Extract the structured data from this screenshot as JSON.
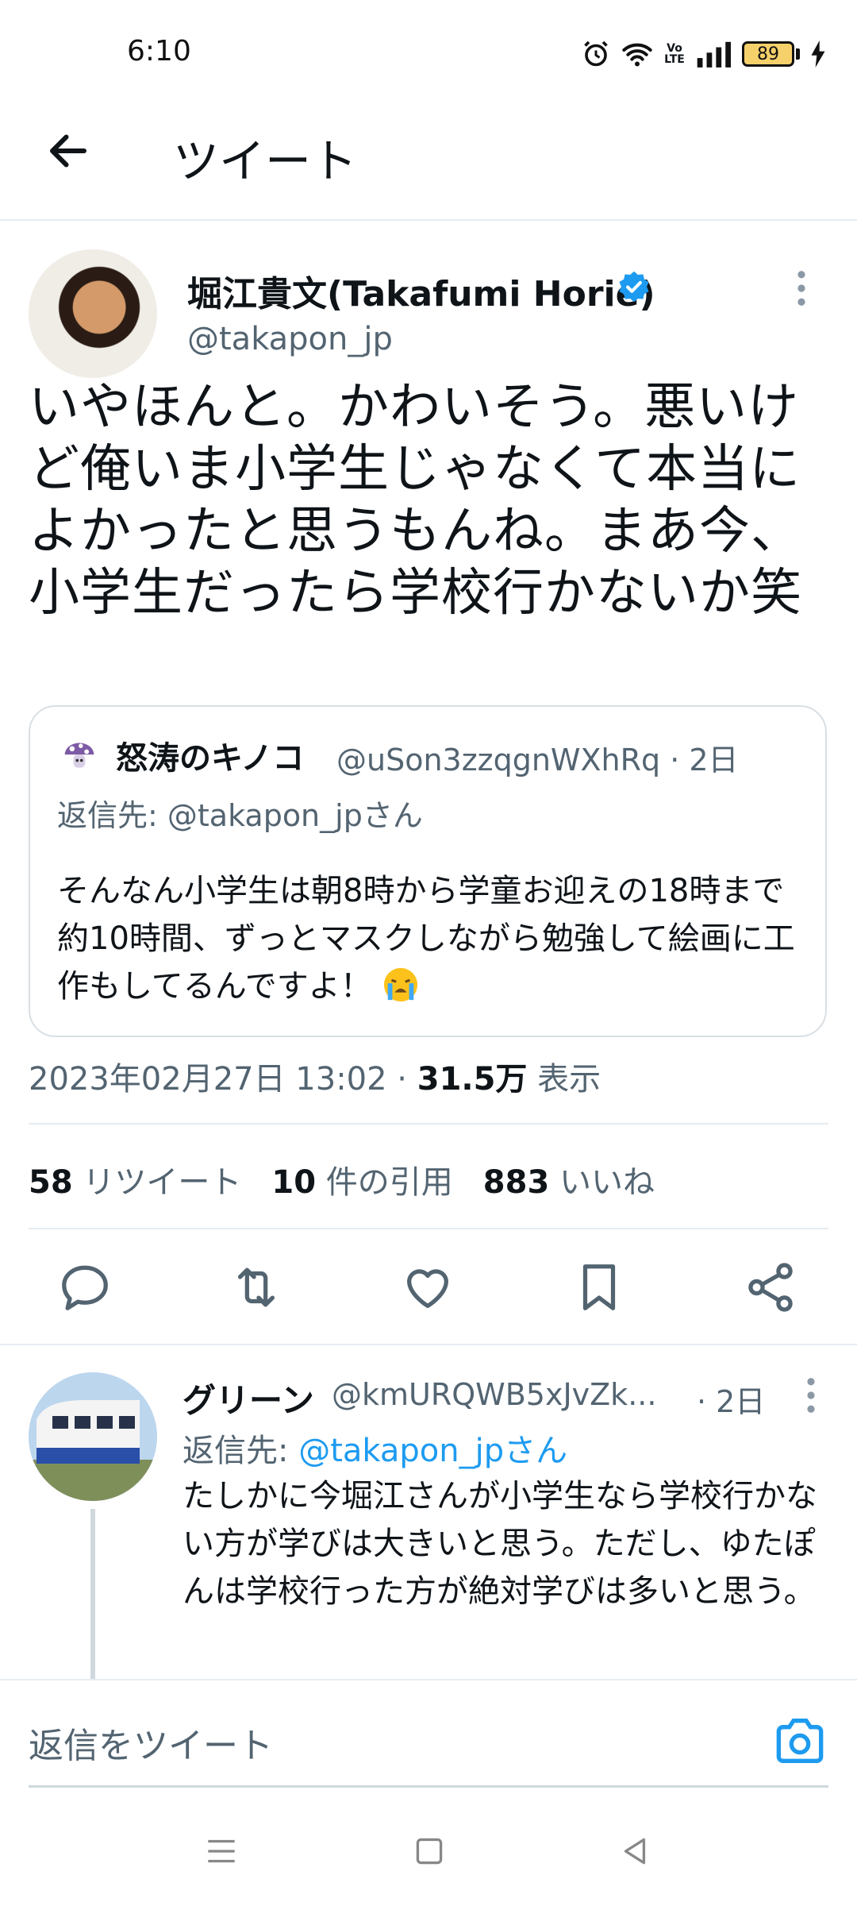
{
  "status_bar": {
    "time": "6:10",
    "battery": "89",
    "network_label": "Vo LTE"
  },
  "header": {
    "title": "ツイート"
  },
  "main_tweet": {
    "author_name": "堀江貴文(Takafumi Horie)",
    "author_handle": "@takapon_jp",
    "text": "いやほんと。かわいそう。悪いけど俺いま小学生じゃなくて本当によかったと思うもんね。まあ今、小学生だったら学校行かないか笑",
    "quote": {
      "author_name": "怒涛のキノコ",
      "author_handle": "@uSon3zzqgnWXhRq · 2日",
      "reply_to": "返信先: @takapon_jpさん",
      "text": "そんなん小学生は朝8時から学童お迎えの18時まで約10時間、ずっとマスクしながら勉強して絵画に工作もしてるんですよ！"
    },
    "timestamp": "2023年02月27日 13:02 · ",
    "views_count": "31.5万",
    "views_label": " 表示",
    "stats": {
      "retweets_count": "58",
      "retweets_label": " リツイート",
      "quotes_count": "10",
      "quotes_label": " 件の引用",
      "likes_count": "883",
      "likes_label": " いいね"
    },
    "actions": [
      "reply-icon",
      "retweet-icon",
      "like-icon",
      "bookmark-icon",
      "share-icon"
    ]
  },
  "reply": {
    "author_name": "グリーン",
    "author_handle": "@kmURQWB5xJvZk...",
    "time": "· 2日",
    "reply_prefix": "返信先: ",
    "reply_to": "@takapon_jpさん",
    "text": "たしかに今堀江さんが小学生なら学校行かない方が学びは大きいと思う。ただし、ゆたぽんは学校行った方が絶対学びは多いと思う。"
  },
  "composer": {
    "placeholder": "返信をツイート"
  },
  "colors": {
    "accent": "#1d9bf0",
    "secondary_text": "#536471",
    "divider": "#e6ecf0"
  }
}
